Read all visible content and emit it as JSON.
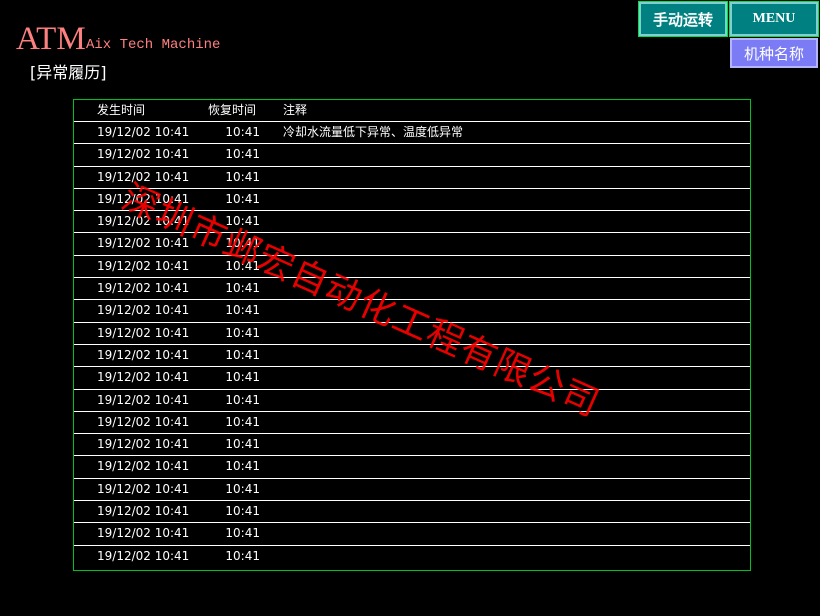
{
  "brand": {
    "logo": "ATM",
    "subtitle": "Aix Tech Machine"
  },
  "page_title": "[异常履历]",
  "buttons": {
    "manual_operation": "手动运转",
    "menu": "MENU",
    "model_name": "机种名称"
  },
  "table": {
    "headers": {
      "occurred": "发生时间",
      "recovered": "恢复时间",
      "note": "注释"
    },
    "rows": [
      {
        "occurred": "19/12/02  10:41",
        "recovered": "10:41",
        "note": "冷却水流量低下异常、温度低异常"
      },
      {
        "occurred": "19/12/02  10:41",
        "recovered": "10:41",
        "note": ""
      },
      {
        "occurred": "19/12/02  10:41",
        "recovered": "10:41",
        "note": ""
      },
      {
        "occurred": "19/12/02  10:41",
        "recovered": "10:41",
        "note": ""
      },
      {
        "occurred": "19/12/02  10:41",
        "recovered": "10:41",
        "note": ""
      },
      {
        "occurred": "19/12/02  10:41",
        "recovered": "10:41",
        "note": ""
      },
      {
        "occurred": "19/12/02  10:41",
        "recovered": "10:41",
        "note": ""
      },
      {
        "occurred": "19/12/02  10:41",
        "recovered": "10:41",
        "note": ""
      },
      {
        "occurred": "19/12/02  10:41",
        "recovered": "10:41",
        "note": ""
      },
      {
        "occurred": "19/12/02  10:41",
        "recovered": "10:41",
        "note": ""
      },
      {
        "occurred": "19/12/02  10:41",
        "recovered": "10:41",
        "note": ""
      },
      {
        "occurred": "19/12/02  10:41",
        "recovered": "10:41",
        "note": ""
      },
      {
        "occurred": "19/12/02  10:41",
        "recovered": "10:41",
        "note": ""
      },
      {
        "occurred": "19/12/02  10:41",
        "recovered": "10:41",
        "note": ""
      },
      {
        "occurred": "19/12/02  10:41",
        "recovered": "10:41",
        "note": ""
      },
      {
        "occurred": "19/12/02  10:41",
        "recovered": "10:41",
        "note": ""
      },
      {
        "occurred": "19/12/02  10:41",
        "recovered": "10:41",
        "note": ""
      },
      {
        "occurred": "19/12/02  10:41",
        "recovered": "10:41",
        "note": ""
      },
      {
        "occurred": "19/12/02  10:41",
        "recovered": "10:41",
        "note": ""
      },
      {
        "occurred": "19/12/02  10:41",
        "recovered": "10:41",
        "note": ""
      }
    ]
  },
  "watermark": "深圳市邺宏自动化工程有限公司",
  "colors": {
    "background": "#000000",
    "brand": "#ff8080",
    "button_teal": "#008080",
    "button_violet": "#7b7bf5",
    "table_border": "#00c020",
    "watermark": "#ff0000"
  }
}
